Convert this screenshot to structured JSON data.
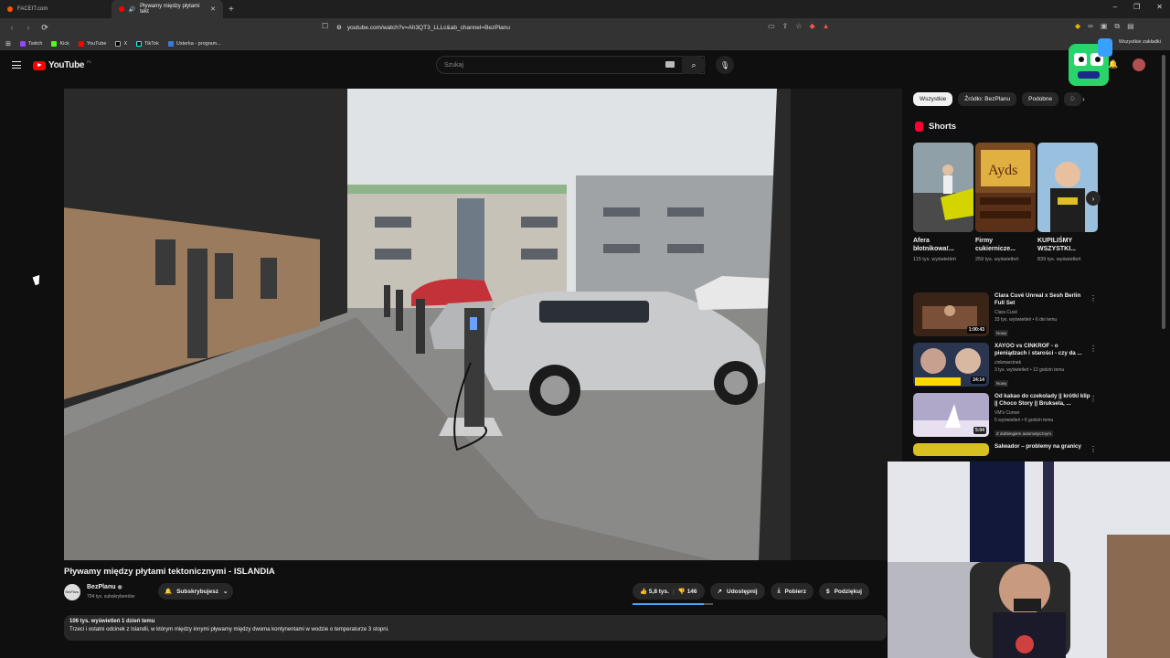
{
  "browser": {
    "tabs": [
      {
        "title": "FACEIT.com",
        "active": false
      },
      {
        "title": "Pływamy między płytami tekt",
        "active": true
      }
    ],
    "url": "youtube.com/watch?v=Ah3QT3_LLLc&ab_channel=BezPlanu",
    "bookmarks": [
      "Twitch",
      "Kick",
      "YouTube",
      "X",
      "TikTok",
      "Usterka - program..."
    ],
    "all_bookmarks": "Wszystkie zakładki"
  },
  "youtube": {
    "logo_text": "YouTube",
    "region": "PL",
    "search_placeholder": "Szukaj"
  },
  "video": {
    "title": "Pływamy między płytami tektonicznymi - ISLANDIA",
    "channel": "BezPlanu",
    "channel_avatar_text": "BezPlanu",
    "subscribers": "704 tys. subskrybentów",
    "subscribe_label": "Subskrybujesz",
    "likes": "5,8 tys.",
    "dislikes": "146",
    "share_label": "Udostępnij",
    "download_label": "Pobierz",
    "thanks_label": "Podziękuj",
    "meta": "106 tys. wyświetleń  1 dzień temu",
    "description": "Trzeci i ostatni odcinek z Islandii, w którym między innymi pływamy między dwoma kontynentami w wodzie o temperaturze 3 stopni."
  },
  "sidebar": {
    "chips": [
      "Wszystkie",
      "Źródło: BezPlanu",
      "Podobne",
      "D"
    ],
    "shorts_heading": "Shorts",
    "shorts": [
      {
        "title": "Afera błotnikowa!...",
        "views": "115 tys. wyświetleń"
      },
      {
        "title": "Firmy cukiernicze...",
        "views": "259 tys. wyświetleń"
      },
      {
        "title": "KUPILIŚMY WSZYSTKI...",
        "views": "839 tys. wyświetleń"
      }
    ],
    "recommendations": [
      {
        "title": "Clara Cuvé Unreal x Sesh Berlin Full Set",
        "channel": "Clara Cuvé",
        "views": "33 tys. wyświetleń • 6 dni temu",
        "badge": "Nowy",
        "duration": "1:00:43"
      },
      {
        "title": "XAYOO vs CINKROF - o pieniądzach i starości - czy da ...",
        "channel": "cinkmarcinek",
        "views": "3 tys. wyświetleń • 12 godzin temu",
        "badge": "Nowy",
        "duration": "24:14"
      },
      {
        "title": "Od kakao do czekolady || krótki klip || Choco Story || Bruksela, ...",
        "channel": "VM's Corner",
        "views": "5 wyświetleń • 6 godzin temu",
        "badge": "Z dubbingiem automatycznym",
        "duration": "5:04"
      },
      {
        "title": "Salwador – problemy na granicy",
        "channel": "",
        "views": "",
        "badge": "",
        "duration": ""
      }
    ]
  },
  "colors": {
    "background": "#0f0f0f",
    "accent_red": "#ff0000",
    "like_bar": "#3ea6ff",
    "chip_bg": "#272727"
  }
}
